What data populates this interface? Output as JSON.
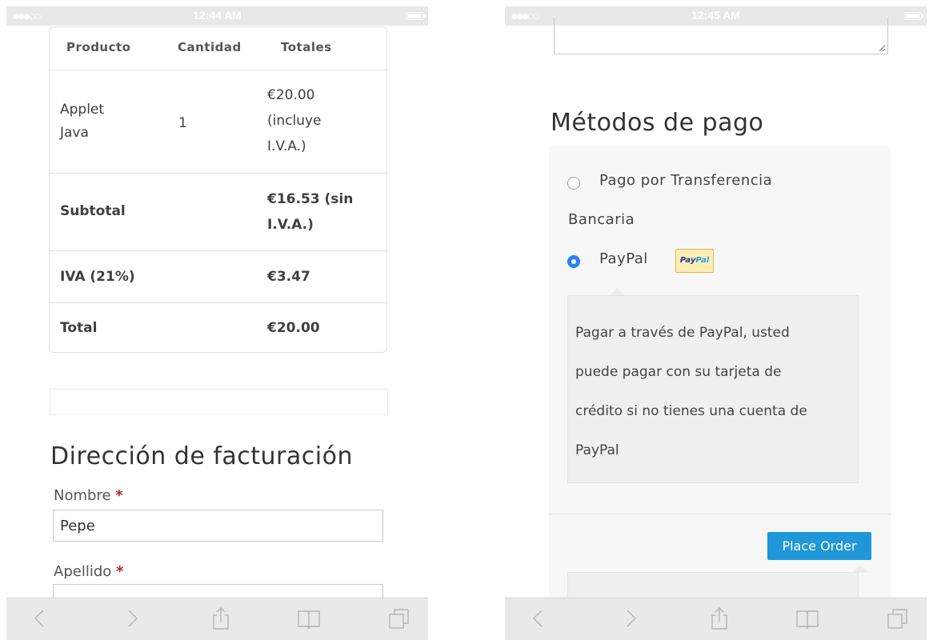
{
  "left": {
    "status": {
      "time": "12:44 AM"
    },
    "order_table": {
      "headers": {
        "product": "Producto",
        "quantity": "Cantidad",
        "totals": "Totales"
      },
      "item": {
        "name_line1": "Applet",
        "name_line2": "Java",
        "quantity": "1",
        "total_line1": "€20.00",
        "total_line2": "(incluye",
        "total_line3": "I.V.A.)"
      },
      "subtotal": {
        "label": "Subtotal",
        "value_line1": "€16.53 (sin",
        "value_line2": "I.V.A.)"
      },
      "tax": {
        "label": "IVA (21%)",
        "value": "€3.47"
      },
      "total": {
        "label": "Total",
        "value": "€20.00"
      }
    },
    "billing": {
      "title": "Dirección de facturación",
      "first_name_label": "Nombre",
      "first_name_value": "Pepe",
      "last_name_label": "Apellido",
      "required_mark": "*"
    }
  },
  "right": {
    "status": {
      "time": "12:45 AM"
    },
    "payment": {
      "title": "Métodos de pago",
      "option1_line1": "Pago por Transferencia",
      "option1_line2": "Bancaria",
      "option2_label": "PayPal",
      "badge_pay": "Pay",
      "badge_pal": "Pal",
      "description_lines": [
        "Pagar a través de PayPal, usted",
        "puede pagar con su tarjeta de",
        "crédito si no tienes una cuenta de",
        "PayPal"
      ],
      "place_order": "Place Order"
    }
  },
  "colors": {
    "accent_button": "#1f97d9",
    "radio_selected": "#2b82f0",
    "required": "#b22222",
    "error_text": "#e02424"
  },
  "icons": [
    "back-icon",
    "forward-icon",
    "share-icon",
    "bookmarks-icon",
    "tabs-icon"
  ]
}
